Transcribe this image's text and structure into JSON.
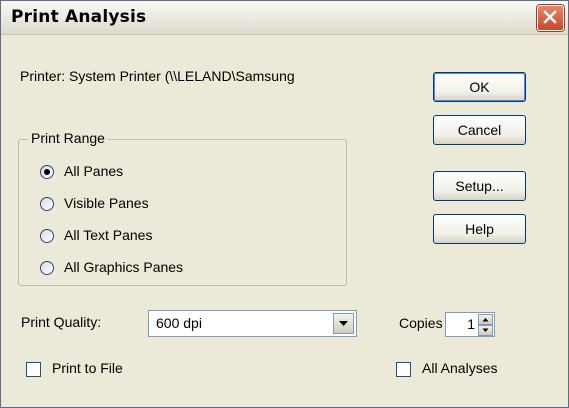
{
  "window": {
    "title": "Print Analysis"
  },
  "printer_label": "Printer:  System Printer (\\\\LELAND\\Samsung",
  "buttons": {
    "ok": "OK",
    "cancel": "Cancel",
    "setup": "Setup...",
    "help": "Help"
  },
  "print_range": {
    "title": "Print Range",
    "options": [
      {
        "label": "All Panes",
        "selected": true
      },
      {
        "label": "Visible Panes",
        "selected": false
      },
      {
        "label": "All Text Panes",
        "selected": false
      },
      {
        "label": "All Graphics Panes",
        "selected": false
      }
    ]
  },
  "print_quality": {
    "label": "Print Quality:",
    "value": "600 dpi"
  },
  "copies": {
    "label": "Copies",
    "value": "1"
  },
  "print_to_file": {
    "label": "Print to File",
    "checked": false
  },
  "all_analyses": {
    "label": "All Analyses",
    "checked": false
  }
}
